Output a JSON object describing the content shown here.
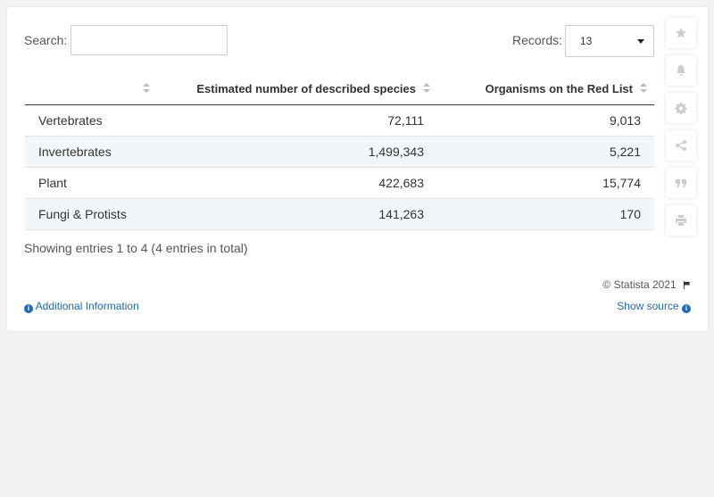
{
  "search": {
    "label": "Search:",
    "value": ""
  },
  "records": {
    "label": "Records:",
    "value": "13"
  },
  "table": {
    "headers": [
      "",
      "Estimated number of described species",
      "Organisms on the Red List"
    ],
    "rows": [
      [
        "Vertebrates",
        "72,111",
        "9,013"
      ],
      [
        "Invertebrates",
        "1,499,343",
        "5,221"
      ],
      [
        "Plant",
        "422,683",
        "15,774"
      ],
      [
        "Fungi & Protists",
        "141,263",
        "170"
      ]
    ]
  },
  "footer": {
    "entries_info": "Showing entries 1 to 4 (4 entries in total)",
    "copyright": "© Statista 2021",
    "additional_info": "Additional Information",
    "show_source": "Show source"
  },
  "sidebar": {
    "icons": [
      "star-icon",
      "bell-icon",
      "gear-icon",
      "share-icon",
      "quote-icon",
      "print-icon"
    ]
  },
  "colors": {
    "link": "#1f6ab0",
    "row_alt": "#f3f6f8",
    "icon_grey": "#cccccc"
  }
}
